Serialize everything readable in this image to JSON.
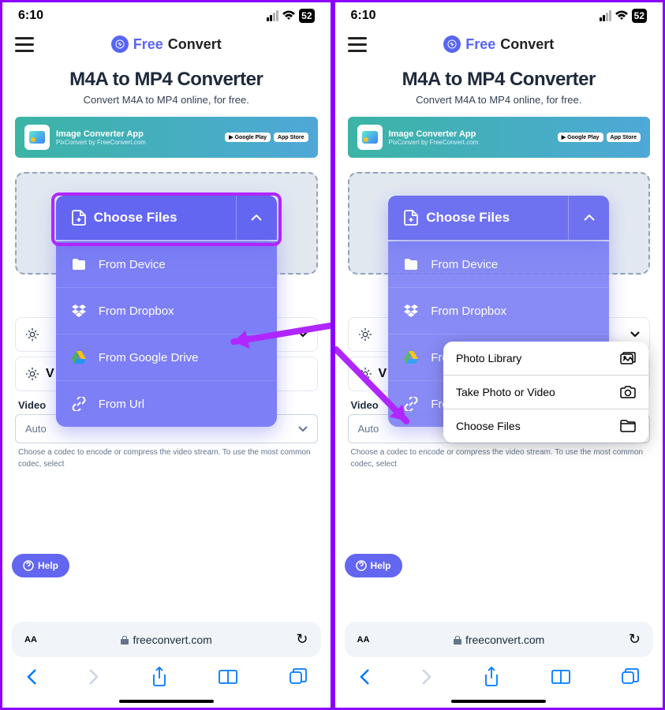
{
  "status": {
    "time": "6:10",
    "battery": "52"
  },
  "logo": {
    "free": "Free",
    "convert": "Convert"
  },
  "title": "M4A to MP4 Converter",
  "subtitle": "Convert M4A to MP4 online, for free.",
  "promo": {
    "title": "Image Converter App",
    "subtitle": "PixConvert by FreeConvert.com",
    "badge1": "Google Play",
    "badge2": "App Store"
  },
  "chooseFiles": "Choose Files",
  "dropdown": {
    "device": "From Device",
    "dropbox": "From Dropbox",
    "gdrive": "From Google Drive",
    "url": "From Url"
  },
  "nativeMenu": {
    "photoLibrary": "Photo Library",
    "takePhoto": "Take Photo or Video",
    "chooseFiles": "Choose Files"
  },
  "settingsLabel": "V",
  "videoLabel": "Video",
  "selectValue": "Auto",
  "helpText": "Choose a codec to encode or compress the video stream. To use the most common codec, select",
  "helpPill": "Help",
  "url": "freeconvert.com",
  "aA": "AA"
}
